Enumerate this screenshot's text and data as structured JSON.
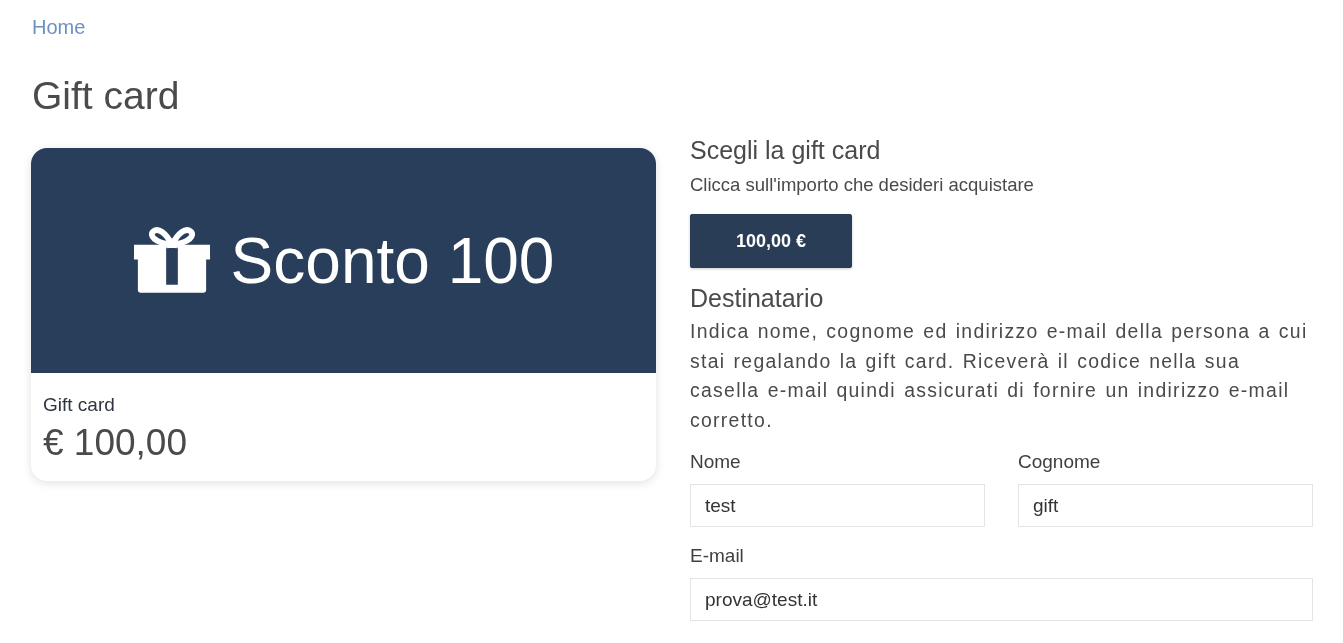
{
  "breadcrumb": [
    {
      "label": "Home"
    }
  ],
  "title": "Gift card",
  "card": {
    "banner_text": "Sconto 100",
    "name": "Gift card",
    "price": "€ 100,00"
  },
  "choose": {
    "heading": "Scegli la gift card",
    "hint": "Clicca sull'importo che desideri acquistare",
    "amounts": [
      {
        "label": "100,00 €",
        "selected": true
      }
    ]
  },
  "recipient": {
    "heading": "Destinatario",
    "description": "Indica nome, cognome ed indirizzo e-mail della persona a cui stai regalando la gift card. Riceverà il codice nella sua casella e-mail quindi assicurati di fornire un indirizzo e-mail corretto.",
    "rows": [
      {
        "fields": [
          {
            "label": "Nome",
            "value": "test"
          },
          {
            "label": "Cognome",
            "value": "gift"
          }
        ]
      },
      {
        "fields": [
          {
            "label": "E-mail",
            "value": "prova@test.it"
          }
        ]
      }
    ]
  }
}
